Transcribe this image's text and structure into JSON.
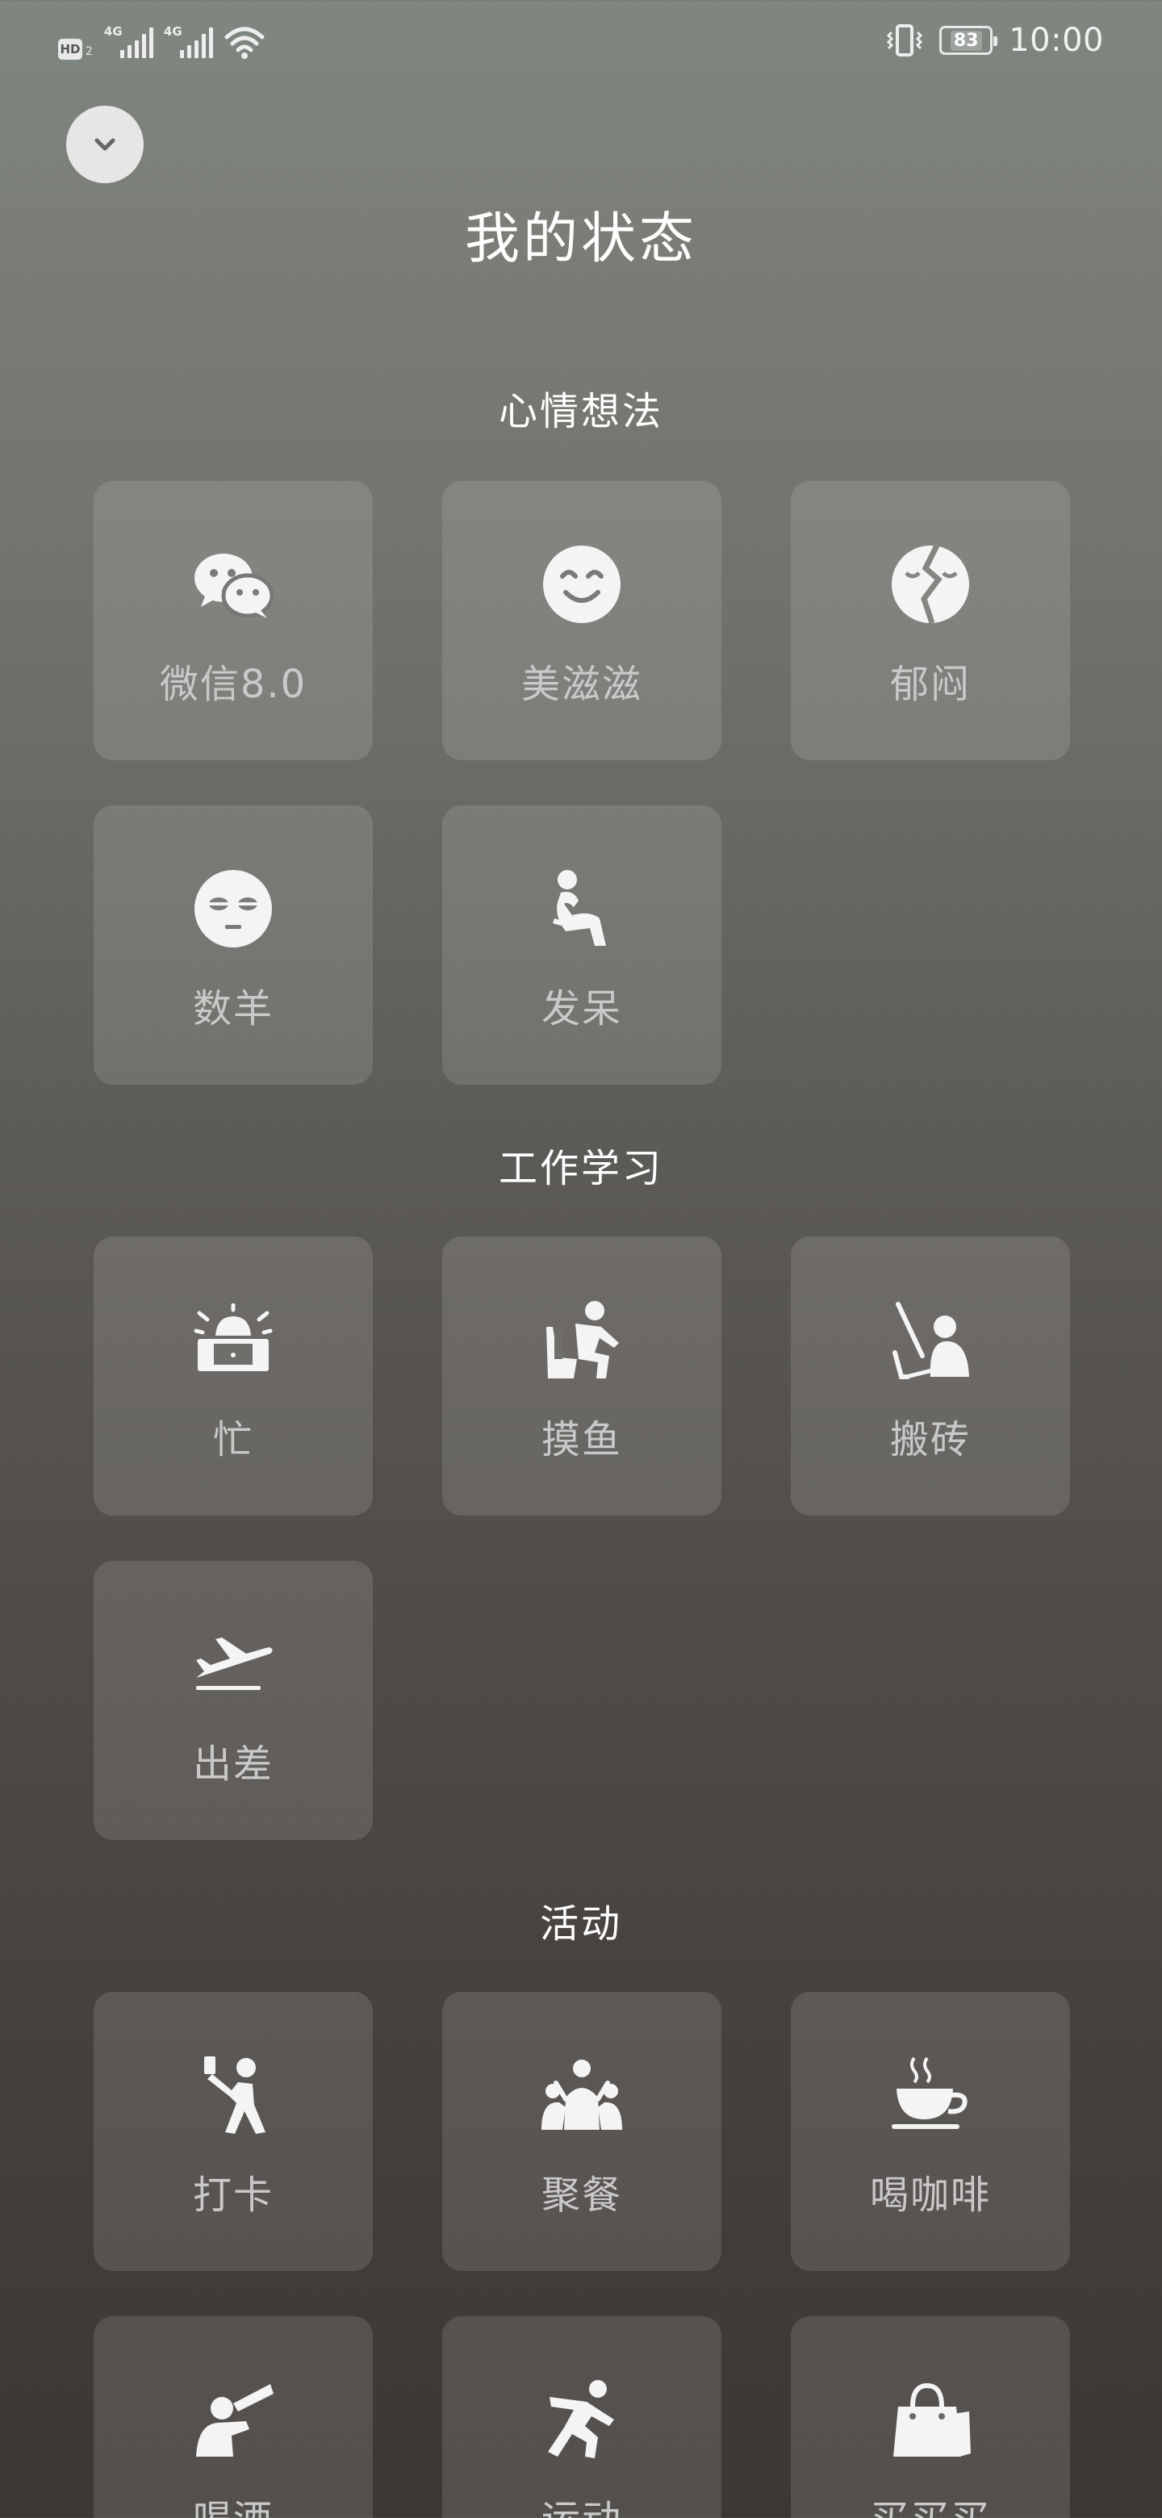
{
  "status_bar": {
    "hd_label": "HD",
    "hd_sub": "2",
    "network_1": "4G",
    "network_2": "4G",
    "battery": "83",
    "time": "10:00"
  },
  "header": {
    "collapse_icon": "chevron-down-icon",
    "title": "我的状态"
  },
  "sections": [
    {
      "title": "心情想法",
      "items": [
        {
          "label": "微信8.0",
          "icon": "wechat-icon"
        },
        {
          "label": "美滋滋",
          "icon": "smile-icon"
        },
        {
          "label": "郁闷",
          "icon": "broken-heart-face-icon"
        },
        {
          "label": "数羊",
          "icon": "sleepy-face-icon"
        },
        {
          "label": "发呆",
          "icon": "thinker-icon"
        }
      ]
    },
    {
      "title": "工作学习",
      "items": [
        {
          "label": "忙",
          "icon": "alarm-laptop-icon"
        },
        {
          "label": "摸鱼",
          "icon": "lazy-sit-icon"
        },
        {
          "label": "搬砖",
          "icon": "worker-icon"
        },
        {
          "label": "出差",
          "icon": "airplane-icon"
        }
      ]
    },
    {
      "title": "活动",
      "items": [
        {
          "label": "打卡",
          "icon": "selfie-icon"
        },
        {
          "label": "聚餐",
          "icon": "group-icon"
        },
        {
          "label": "喝咖啡",
          "icon": "coffee-icon"
        },
        {
          "label": "喝酒",
          "icon": "drink-icon"
        },
        {
          "label": "运动",
          "icon": "running-icon"
        },
        {
          "label": "买买买",
          "icon": "shopping-bag-icon"
        }
      ]
    }
  ]
}
